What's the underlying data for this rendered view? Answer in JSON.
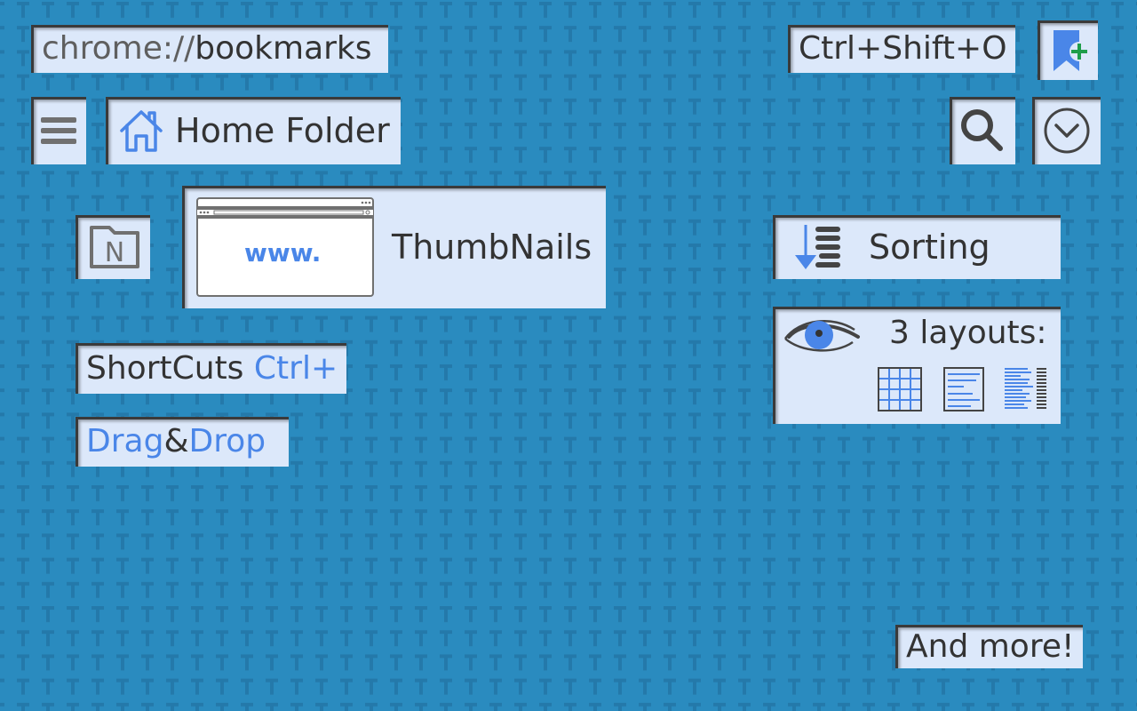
{
  "background": {
    "color": "#2a8bbf",
    "pattern_glyph": "T",
    "pattern_color": "#2479aa"
  },
  "colors": {
    "box_bg": "#dce8fa",
    "accent_blue": "#4a86e8",
    "text_dark": "#333333",
    "text_grey": "#5f5f5f",
    "plus_green": "#1e9e4a"
  },
  "url_bar": {
    "scheme": "chrome://",
    "path": "bookmarks"
  },
  "shortcut_open": {
    "label": "Ctrl+Shift+O"
  },
  "add_bookmark": {
    "icon": "bookmark-add-icon"
  },
  "menu": {
    "icon": "hamburger-menu-icon"
  },
  "home_folder": {
    "icon": "home-icon",
    "label": "Home Folder"
  },
  "search": {
    "icon": "search-icon"
  },
  "dropdown": {
    "icon": "chevron-down-circle-icon"
  },
  "folder_n": {
    "icon": "folder-icon",
    "letter": "N"
  },
  "thumbnails": {
    "preview_text": "www.",
    "label": "ThumbNails"
  },
  "sorting": {
    "icon": "sort-descending-icon",
    "label": "Sorting"
  },
  "layouts": {
    "icon": "eye-icon",
    "label": "3 layouts:",
    "options": [
      "grid-layout-icon",
      "list-layout-icon",
      "compact-list-layout-icon"
    ]
  },
  "shortcuts": {
    "label": "ShortCuts",
    "keys": "Ctrl+"
  },
  "drag_drop": {
    "part1": "Drag",
    "amp": "&",
    "part2": "Drop"
  },
  "and_more": {
    "label": "And more!"
  }
}
